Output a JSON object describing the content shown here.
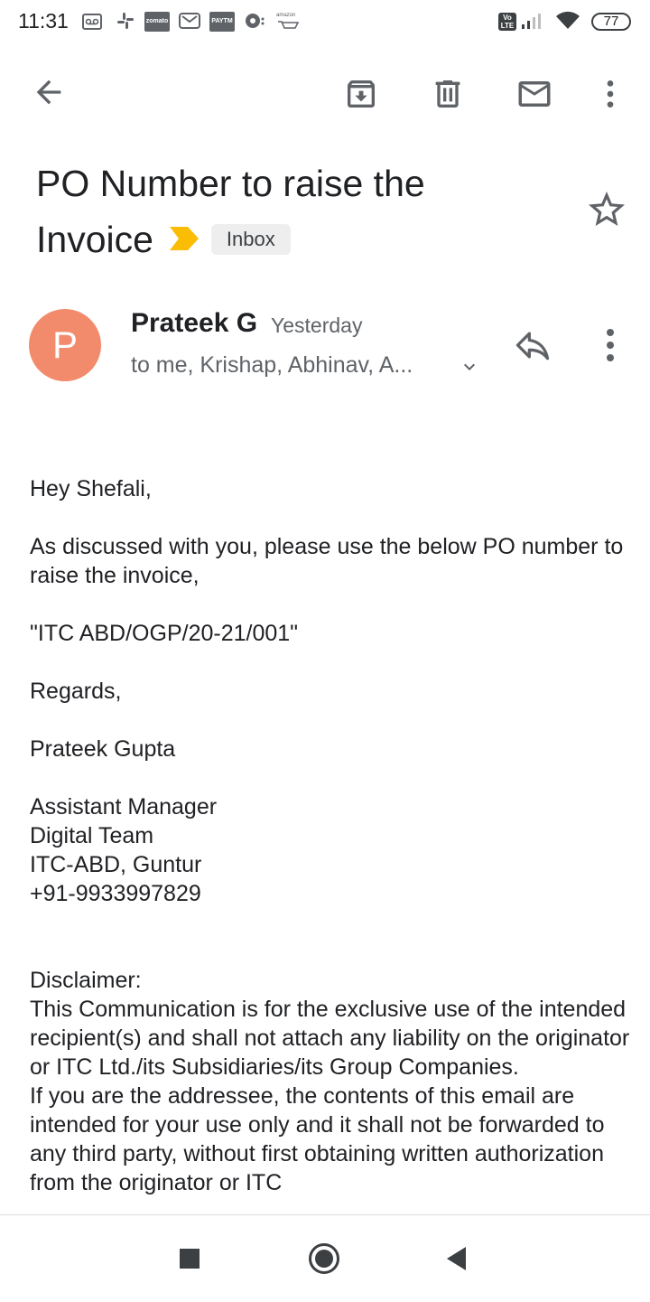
{
  "status_bar": {
    "time": "11:31",
    "icons": [
      "voicemail-icon",
      "slack-icon",
      "zomato-icon",
      "gmail-icon",
      "paytm-icon",
      "app-icon",
      "amazon-icon"
    ],
    "zomato_label": "zomato",
    "paytm_label": "PAYTM",
    "amazon_label": "amazon",
    "network_label": "Vo LTE",
    "battery": "77"
  },
  "toolbar": {
    "icons": [
      "back-arrow-icon",
      "archive-icon",
      "delete-icon",
      "mark-unread-icon",
      "more-vert-icon"
    ]
  },
  "email": {
    "subject": "PO Number to raise the Invoice",
    "label": "Inbox",
    "sender_initial": "P",
    "sender_name": "Prateek G",
    "time": "Yesterday",
    "recipients": "to me, Krishap, Abhinav, A...",
    "body": {
      "greeting": "Hey Shefali,",
      "line1": "As discussed with you, please use the below PO number to raise the invoice,",
      "po_number": "\"ITC ABD/OGP/20-21/001\"",
      "regards": "Regards,",
      "sig_name": "Prateek Gupta",
      "sig_title": "Assistant Manager",
      "sig_team": "Digital Team",
      "sig_location": "ITC-ABD, Guntur",
      "sig_phone": "+91-9933997829",
      "disclaimer_heading": "Disclaimer:",
      "disclaimer_p1": "This Communication is for the exclusive use of the intended recipient(s) and shall not attach any liability on the originator or ITC Ltd./its Subsidiaries/its Group Companies.",
      "disclaimer_p2": "If you are the addressee, the contents of this email are intended for your use only and it shall not be forwarded to any third party, without first obtaining written authorization from the originator or ITC"
    }
  },
  "nav_bar": {
    "icons": [
      "recents-square-icon",
      "home-circle-icon",
      "back-triangle-icon"
    ]
  },
  "colors": {
    "avatar": "#f28b6b",
    "label_arrow": "#fbbc04",
    "chip_bg": "#eeeeee",
    "icon_gray": "#5f6368"
  }
}
